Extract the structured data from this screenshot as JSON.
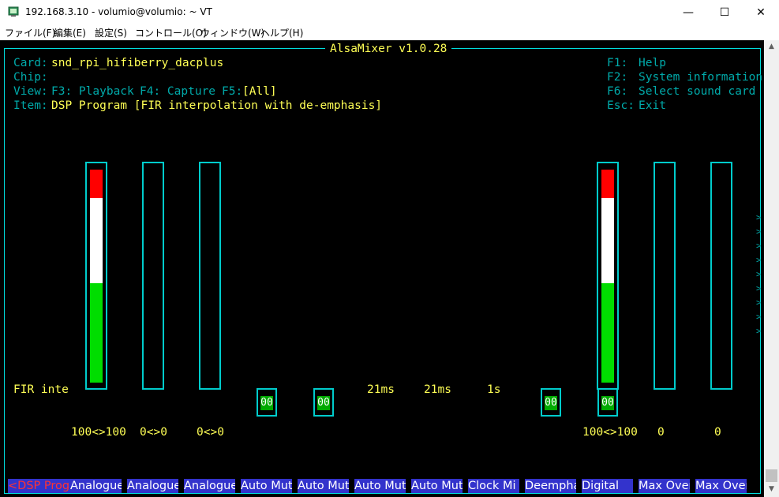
{
  "window": {
    "title": "192.168.3.10 - volumio@volumio: ~ VT",
    "minimize": "—",
    "maximize": "☐",
    "close": "✕"
  },
  "menu": [
    "ファイル(F)",
    "編集(E)",
    "設定(S)",
    "コントロール(O)",
    "ウィンドウ(W)",
    "ヘルプ(H)"
  ],
  "mixer": {
    "title": "AlsaMixer v1.0.28",
    "card_label": "Card:",
    "card_value": "snd_rpi_hifiberry_dacplus",
    "chip_label": "Chip:",
    "view_label": "View:",
    "view_playback": "F3: Playback",
    "view_capture": "F4: Capture",
    "view_all_key": "F5:",
    "view_all": "[All]",
    "item_label": "Item:",
    "item_value": "DSP Program [FIR interpolation with de-emphasis]",
    "help": [
      {
        "key": "F1:",
        "text": "Help"
      },
      {
        "key": "F2:",
        "text": "System information"
      },
      {
        "key": "F6:",
        "text": "Select sound card"
      },
      {
        "key": "Esc:",
        "text": "Exit"
      }
    ],
    "enum_value": "FIR inte",
    "timing_values": [
      "21ms",
      "21ms",
      "1s"
    ],
    "switch_text": "00",
    "levels": {
      "analogue1": "100<>100",
      "analogue2": "0<>0",
      "analogue3": "0<>0",
      "digital": "100<>100",
      "max_over1": "0",
      "max_over2": "0"
    },
    "controls": [
      "<DSP Prog>",
      "Analogue",
      "Analogue",
      "Analogue",
      "Auto Mut",
      "Auto Mut",
      "Auto Mut",
      "Auto Mut",
      "Clock Mi",
      "Deemphas",
      "Digital",
      "Max Over",
      "Max Over"
    ],
    "scroll_arrow": ">"
  },
  "colors": {
    "cyan": "#00aaaa",
    "yellow": "#ffff55",
    "label_bg": "#3333cc",
    "meter_red": "#ff0000",
    "meter_white": "#ffffff",
    "meter_green": "#00dd00"
  }
}
